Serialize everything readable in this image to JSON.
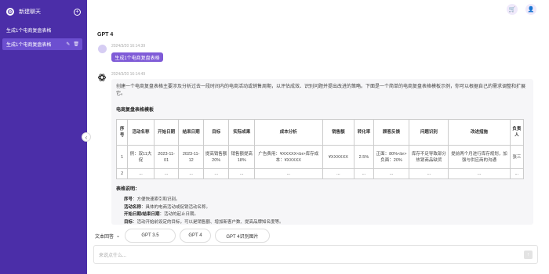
{
  "sidebar": {
    "new_chat_label": "新建聊天",
    "conversations": [
      {
        "label": "生成1个电商复盘表格"
      },
      {
        "label": "生成1个电商复盘表格"
      }
    ]
  },
  "header": {
    "model": "GPT 4"
  },
  "user_msg": {
    "time": "2024/3/20 16:14:39",
    "text": "生成1个电商复盘表格"
  },
  "bot_msg": {
    "time": "2024/3/20 16:14:49",
    "intro": "创建一个电商复盘表格主要涉及分析过去一段时间内的电商活动或销售周期，以评估成效、识别问题并提出改进的策略。下面是一个简单的电商复盘表格模板示例，你可以根据自己的需求调整和扩展它。",
    "table_title": "电商复盘表格模板",
    "table": {
      "headers": [
        "序号",
        "活动名称",
        "开始日期",
        "结束日期",
        "目标",
        "实际成果",
        "成本分析",
        "销售额",
        "转化率",
        "顾客反馈",
        "问题识别",
        "改进措施",
        "负责人"
      ],
      "rows": [
        [
          "1",
          "例：双11大促",
          "2023-11-01",
          "2023-11-12",
          "提高销售额20%",
          "销售额提高18%",
          "广告费用：¥XXXXX<br>库存成本：¥XXXXX",
          "¥XXXXXX",
          "2.5%",
          "正面：80%<br>负面：20%",
          "库存不足导致部分热销商品缺货",
          "提前两个月进行库存规划，加强与供应商的沟通",
          "张三"
        ],
        [
          "2",
          "...",
          "...",
          "...",
          "...",
          "...",
          "...",
          "...",
          "...",
          "...",
          "...",
          "...",
          "..."
        ]
      ]
    },
    "notes_title": "表格说明：",
    "notes": [
      {
        "k": "序号",
        "v": "：方便快速索引和识别。"
      },
      {
        "k": "活动名称",
        "v": "：具体的电商活动或促销活动名称。"
      },
      {
        "k": "开始日期/结束日期",
        "v": "：活动的起止日期。"
      },
      {
        "k": "目标",
        "v": "：活动开始前设定的目标，可以是销售额、增加新客户数、提高品牌知名度等。"
      }
    ]
  },
  "bottom": {
    "mode_label": "文本回答",
    "chips": [
      "GPT 3.5",
      "GPT 4",
      "GPT 4识别图片"
    ],
    "input_placeholder": "来说点什么..."
  },
  "colors": {
    "sidebar": "#4b2ea8",
    "active": "#6c4fd0",
    "accent": "#7f5bd7"
  }
}
